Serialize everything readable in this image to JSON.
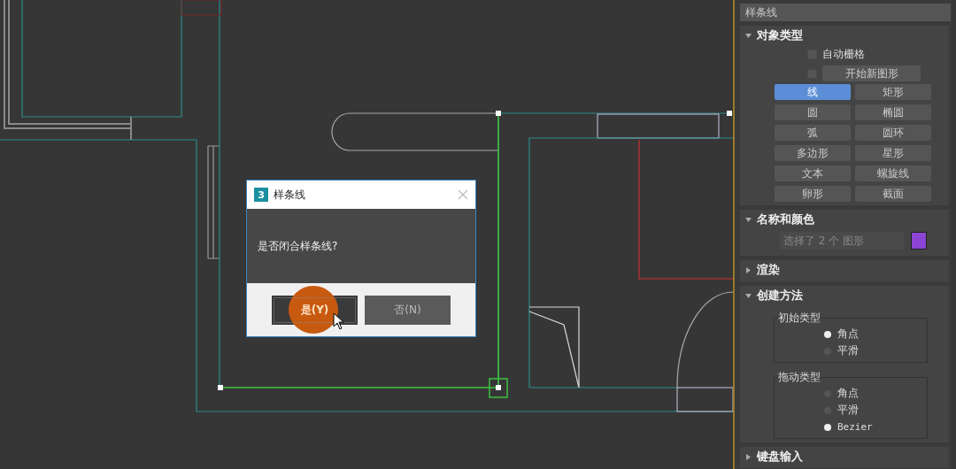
{
  "dialog": {
    "logo": "3",
    "title": "样条线",
    "message": "是否闭合样条线?",
    "buttons": [
      {
        "label": "是(Y)",
        "focused": true
      },
      {
        "label": "否(N)",
        "focused": false
      }
    ]
  },
  "panel": {
    "title": "样条线",
    "object_type": {
      "title": "对象类型",
      "expanded": true,
      "auto_grid": {
        "label": "自动栅格",
        "checked": false
      },
      "start_new_shape": {
        "label": "开始新图形",
        "checked": false
      },
      "shapes": [
        {
          "label": "线",
          "selected": true
        },
        {
          "label": "矩形",
          "selected": false
        },
        {
          "label": "圆",
          "selected": false
        },
        {
          "label": "椭圆",
          "selected": false
        },
        {
          "label": "弧",
          "selected": false
        },
        {
          "label": "圆环",
          "selected": false
        },
        {
          "label": "多边形",
          "selected": false
        },
        {
          "label": "星形",
          "selected": false
        },
        {
          "label": "文本",
          "selected": false
        },
        {
          "label": "螺旋线",
          "selected": false
        },
        {
          "label": "卵形",
          "selected": false
        },
        {
          "label": "截面",
          "selected": false
        }
      ]
    },
    "name_and_color": {
      "title": "名称和颜色",
      "expanded": true,
      "name": "选择了 2 个 图形",
      "color": "#8c44d4"
    },
    "rendering": {
      "title": "渲染",
      "expanded": false
    },
    "creation_method": {
      "title": "创建方法",
      "expanded": true,
      "groups": [
        {
          "title": "初始类型",
          "options": [
            {
              "label": "角点",
              "selected": true
            },
            {
              "label": "平滑",
              "selected": false
            }
          ]
        },
        {
          "title": "拖动类型",
          "options": [
            {
              "label": "角点",
              "selected": false
            },
            {
              "label": "平滑",
              "selected": false
            },
            {
              "label": "Bezier",
              "selected": true
            }
          ]
        }
      ]
    },
    "keyboard_entry": {
      "title": "键盘输入",
      "expanded": false
    }
  }
}
